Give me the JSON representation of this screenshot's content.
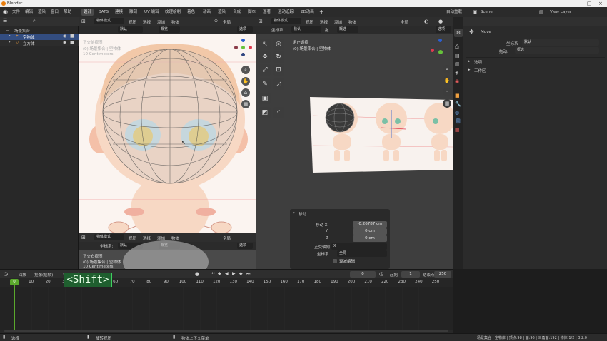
{
  "app": {
    "title": "Blender"
  },
  "menu": {
    "file": "文件",
    "edit": "编辑",
    "render": "渲染",
    "window": "窗口",
    "help": "帮助"
  },
  "workspaces": [
    "设计",
    "BATS",
    "建模",
    "雕刻",
    "UV 编辑",
    "纹理绘制",
    "着色",
    "动画",
    "渲染",
    "合成",
    "脚本",
    "逼著",
    "运动追踪",
    "2D动画"
  ],
  "topright": {
    "autosave": "自动重载",
    "scene": "Scene",
    "view_layer": "View Layer"
  },
  "outliner": {
    "collection": "场景集合",
    "empty": "空物体",
    "cube": "立方体"
  },
  "left_view": {
    "mode": "物体模式",
    "menus": [
      "视图",
      "选择",
      "添加",
      "物体"
    ],
    "default": "默认",
    "global": "全局",
    "snap": "概览",
    "options": "选项",
    "info1": "正交前视图",
    "info2": "(0) 场景集合 | 空物体",
    "info3": "10 Centimeters"
  },
  "bottom_view": {
    "mode": "物体模式",
    "menus": [
      "视图",
      "选择",
      "添加",
      "物体"
    ],
    "coord": "坐标系:",
    "default": "默认",
    "snap": "概览",
    "options": "选项",
    "global": "全局",
    "info1": "正交右视图",
    "info2": "(0) 场景集合 | 空物体",
    "info3": "10 Centimeters"
  },
  "right_view": {
    "mode": "物体模式",
    "menus": [
      "视图",
      "选择",
      "添加",
      "物体"
    ],
    "coord": "坐标系:",
    "default": "默认",
    "drag": "拖...",
    "snap": "概选",
    "global": "全局",
    "options": "选项",
    "info1": "用户透视",
    "info2": "(0) 场景集合 | 空物体"
  },
  "operator": {
    "title": "移动",
    "move_x": "移动 X",
    "x_val": "-0.26787 cm",
    "y_label": "Y",
    "y_val": "0 cm",
    "z_label": "Z",
    "z_val": "0 cm",
    "ortho_label": "正交轴向",
    "ortho_val": "X",
    "coord_label": "坐标系",
    "coord_val": "全局",
    "prop_edit": "衰减编辑"
  },
  "props": {
    "tool": "Move",
    "coord_label": "坐标系",
    "coord_val": "默认",
    "drag_label": "拖动:",
    "drag_val": "框选",
    "options": "选项",
    "workspace": "工作区"
  },
  "timeline": {
    "playback": "回放",
    "keying": "抠像(插帧)",
    "view": "视图",
    "marker": "标记",
    "frame": "0",
    "start_label": "起始",
    "start": "1",
    "end_label": "结束点",
    "end": "250",
    "ticks": [
      "0",
      "10",
      "20",
      "30",
      "40",
      "50",
      "60",
      "70",
      "80",
      "90",
      "100",
      "110",
      "120",
      "130",
      "140",
      "150",
      "160",
      "170",
      "180",
      "190",
      "200",
      "210",
      "220",
      "230",
      "240",
      "250"
    ],
    "shift_overlay": "<Shift>"
  },
  "status": {
    "select": "选择",
    "rotate_view": "旋转视图",
    "context_menu": "物体上下文菜单",
    "stats": "场景集合 | 空物体 | 顶点:98 | 面:96 | 三角面:192 | 物体:1/2 | 3.2.0"
  },
  "colors": {
    "accent": "#4772b3",
    "active_frame": "#5aa82c",
    "header": "#303030"
  }
}
